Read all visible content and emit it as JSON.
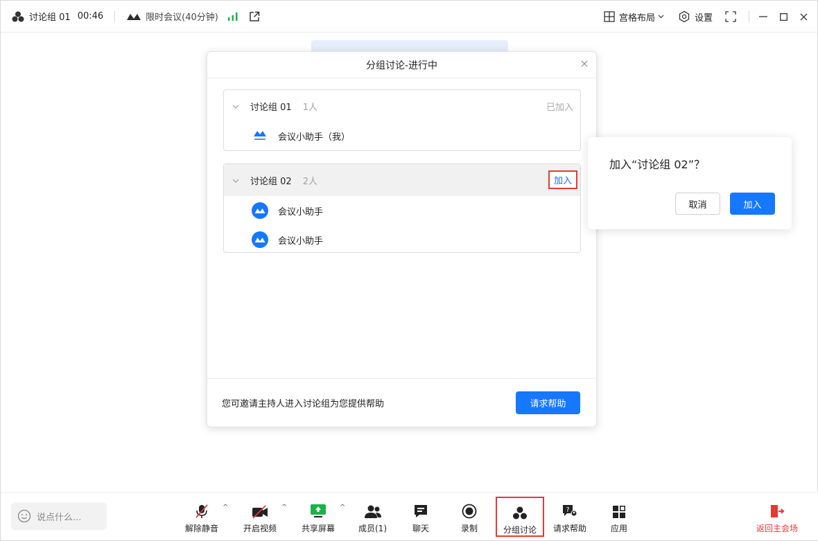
{
  "topbar": {
    "group_label": "讨论组 01",
    "timer": "00:46",
    "meeting_type": "限时会议(40分钟)",
    "layout_label": "宫格布局",
    "settings_label": "设置"
  },
  "dialog": {
    "title": "分组讨论-进行中",
    "groups": [
      {
        "name": "讨论组 01",
        "count": "1人",
        "status": "已加入",
        "members": [
          "会议小助手（我）"
        ]
      },
      {
        "name": "讨论组 02",
        "count": "2人",
        "action": "加入",
        "members": [
          "会议小助手",
          "会议小助手"
        ]
      }
    ],
    "footer_text": "您可邀请主持人进入讨论组为您提供帮助",
    "help_button": "请求帮助"
  },
  "popover": {
    "question": "加入“讨论组 02”？",
    "cancel": "取消",
    "confirm": "加入"
  },
  "toolbar": {
    "chat_placeholder": "说点什么...",
    "tools": [
      {
        "label": "解除静音",
        "icon": "mic-muted-icon"
      },
      {
        "label": "开启视频",
        "icon": "camera-off-icon"
      },
      {
        "label": "共享屏幕",
        "icon": "share-screen-icon"
      },
      {
        "label": "成员(1)",
        "icon": "members-icon"
      },
      {
        "label": "聊天",
        "icon": "chat-icon"
      },
      {
        "label": "录制",
        "icon": "record-icon"
      },
      {
        "label": "分组讨论",
        "icon": "breakout-icon"
      },
      {
        "label": "请求帮助",
        "icon": "help-request-icon"
      },
      {
        "label": "应用",
        "icon": "apps-icon"
      }
    ],
    "exit_label": "返回主会场"
  },
  "colors": {
    "accent": "#1677ff",
    "highlight_box": "#e53935",
    "signal": "#19b34a"
  }
}
